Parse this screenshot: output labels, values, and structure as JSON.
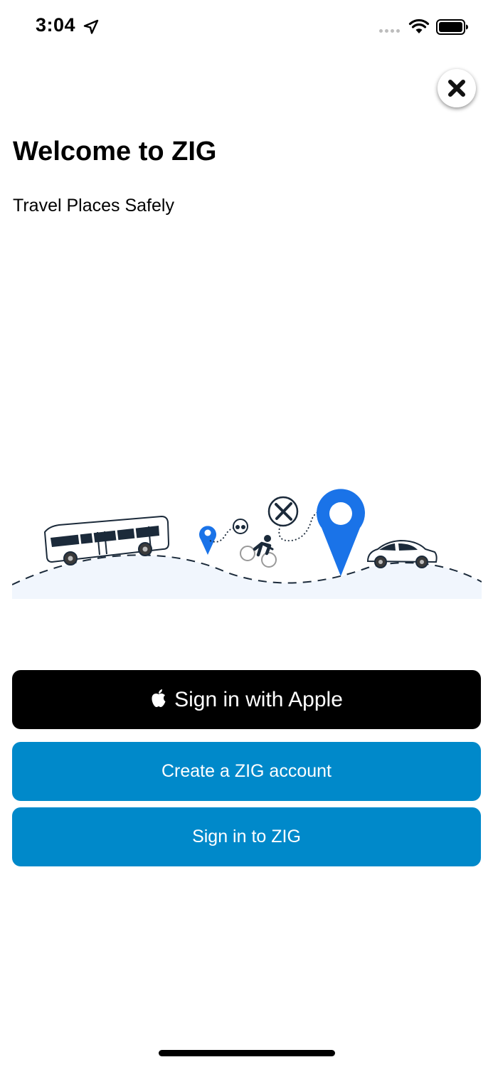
{
  "status_bar": {
    "time": "3:04"
  },
  "header": {
    "title": "Welcome to ZIG",
    "subtitle": "Travel Places Safely"
  },
  "buttons": {
    "apple_label": "Sign in with Apple",
    "create_label": "Create a ZIG account",
    "signin_label": "Sign in to ZIG"
  },
  "colors": {
    "primary_blue": "#0089ca",
    "pin_blue": "#1a73e8",
    "dark_navy": "#1b2a3a"
  }
}
